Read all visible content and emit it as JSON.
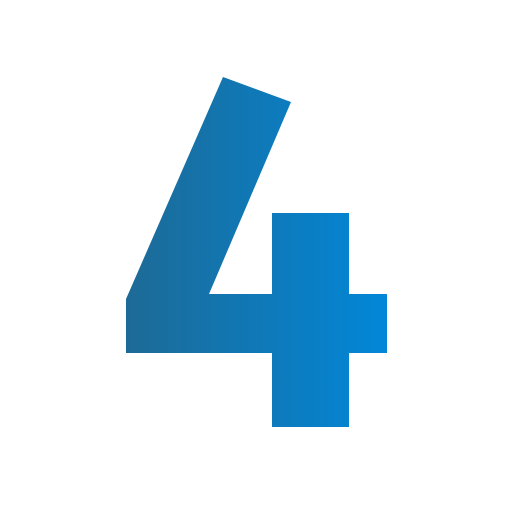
{
  "logo": {
    "digit": "4",
    "gradient_start": "#1D6A96",
    "gradient_end": "#0287D8"
  }
}
